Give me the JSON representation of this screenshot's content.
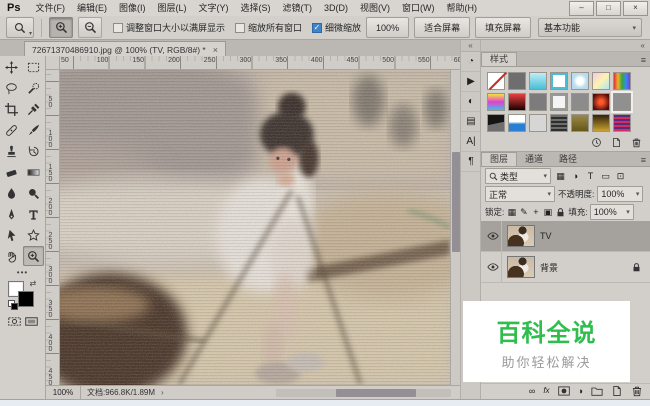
{
  "window": {
    "minimize": "–",
    "maximize": "□",
    "close": "×"
  },
  "menu_bar": {
    "logo": "Ps",
    "items": [
      "文件(F)",
      "编辑(E)",
      "图像(I)",
      "图层(L)",
      "文字(Y)",
      "选择(S)",
      "滤镜(T)",
      "3D(D)",
      "视图(V)",
      "窗口(W)",
      "帮助(H)"
    ]
  },
  "options_bar": {
    "checkboxes": [
      {
        "label": "调整窗口大小以满屏显示",
        "checked": false
      },
      {
        "label": "缩放所有窗口",
        "checked": false
      },
      {
        "label": "细微缩放",
        "checked": true
      }
    ],
    "buttons": [
      "100%",
      "适合屏幕",
      "填充屏幕"
    ],
    "workspace": "基本功能"
  },
  "document_tab": {
    "title": "72671370486910.jpg @ 100% (TV, RGB/8#) *",
    "close": "×"
  },
  "toolbar": {
    "rows": [
      [
        {
          "name": "move-tool",
          "icon": "move"
        },
        {
          "name": "marquee-tool",
          "icon": "marquee"
        }
      ],
      [
        {
          "name": "lasso-tool",
          "icon": "lasso"
        },
        {
          "name": "quick-selection-tool",
          "icon": "wand"
        }
      ],
      [
        {
          "name": "crop-tool",
          "icon": "crop"
        },
        {
          "name": "eyedropper-tool",
          "icon": "eyedropper"
        }
      ],
      [
        {
          "name": "healing-brush-tool",
          "icon": "healing"
        },
        {
          "name": "brush-tool",
          "icon": "brush"
        }
      ],
      [
        {
          "name": "clone-stamp-tool",
          "icon": "stamp"
        },
        {
          "name": "history-brush-tool",
          "icon": "hbrush"
        }
      ],
      [
        {
          "name": "eraser-tool",
          "icon": "eraser"
        },
        {
          "name": "gradient-tool",
          "icon": "gradient"
        }
      ],
      [
        {
          "name": "blur-tool",
          "icon": "blur"
        },
        {
          "name": "dodge-tool",
          "icon": "dodge"
        }
      ],
      [
        {
          "name": "pen-tool",
          "icon": "pen"
        },
        {
          "name": "type-tool",
          "icon": "type"
        }
      ],
      [
        {
          "name": "path-selection-tool",
          "icon": "pathsel"
        },
        {
          "name": "custom-shape-tool",
          "icon": "shape"
        }
      ],
      [
        {
          "name": "hand-tool",
          "icon": "hand"
        },
        {
          "name": "zoom-tool",
          "icon": "zoomin",
          "selected": true
        }
      ]
    ],
    "more_label": "•••",
    "foreground_color": "#ffffff",
    "background_color": "#000000"
  },
  "rulers": {
    "horizontal_labels": [
      50,
      100,
      150,
      200,
      250,
      300,
      350,
      400,
      450,
      500,
      550,
      600
    ],
    "vertical_labels": [
      50,
      100,
      150,
      200,
      250,
      300,
      350,
      400,
      450
    ]
  },
  "status_bar": {
    "zoom": "100%",
    "document_info": "文档:966.8K/1.89M",
    "arrow": "›"
  },
  "panel_strip": [
    {
      "name": "history-panel-icon",
      "glyph": "◔"
    },
    {
      "name": "actions-panel-icon",
      "glyph": "▶"
    },
    {
      "name": "adjustments-panel-icon",
      "glyph": "◐"
    },
    {
      "name": "layer-comps-panel-icon",
      "glyph": "▤"
    },
    {
      "name": "character-panel-icon",
      "glyph": "A|"
    },
    {
      "name": "paragraph-panel-icon",
      "glyph": "¶"
    }
  ],
  "styles_panel": {
    "tab": "样式",
    "menu_glyph": "≡",
    "swatches": [
      {
        "name": "style-none",
        "css": "#ffffff",
        "slash": true
      },
      {
        "name": "style-dark-gray",
        "css": "#6e6e6e"
      },
      {
        "name": "style-cyan",
        "css": "linear-gradient(180deg,#bfeef7,#49bdd8)"
      },
      {
        "name": "style-cyan-ring",
        "css": "#ffffff",
        "ring": "#49bdd8"
      },
      {
        "name": "style-blue-dot",
        "css": "radial-gradient(circle,#ffffff 28%,#b8dcee 62%)"
      },
      {
        "name": "style-pastel",
        "css": "linear-gradient(135deg,#f6c6e6,#fff2ae,#aee6f6)"
      },
      {
        "name": "style-rainbow-stripes",
        "css": "linear-gradient(90deg,#d93333,#f0b22e,#3aa53a,#2e8ef0,#8a33e0)"
      },
      {
        "name": "style-rainbow",
        "css": "linear-gradient(180deg,#f2e342,#e23fcf,#3fc0e8)"
      },
      {
        "name": "style-red-black",
        "css": "linear-gradient(180deg,#e84040,#1c0000)"
      },
      {
        "name": "style-gray-1",
        "css": "#7c7c7c"
      },
      {
        "name": "style-white-outline",
        "css": "#f4f4f4",
        "ring": "#999999"
      },
      {
        "name": "style-gray-2",
        "css": "#8c8c8c"
      },
      {
        "name": "style-red-radial",
        "css": "radial-gradient(circle,#ff5a2a 18%,#570a0a 80%)"
      },
      {
        "name": "style-gray-selected",
        "css": "#909090",
        "selected": true
      },
      {
        "name": "style-black-wave",
        "css": "linear-gradient(168deg,#151515 52%,#6e6e6e 53%)"
      },
      {
        "name": "style-blue-wave",
        "css": "linear-gradient(180deg,#ffffff 42%,#2a7fd4 58%)"
      },
      {
        "name": "style-light-gray",
        "css": "#d6d6d6"
      },
      {
        "name": "style-dark-stripes",
        "css": "repeating-linear-gradient(0deg,#2e2e2e 0 2px,#6e6e6e 2px 4px)"
      },
      {
        "name": "style-olive",
        "css": "linear-gradient(180deg,#9a8a4a,#655718)"
      },
      {
        "name": "style-dark-gold",
        "css": "linear-gradient(180deg,#32230c,#c8a22e)"
      },
      {
        "name": "style-purple-red",
        "css": "repeating-linear-gradient(0deg,#cf3060 0 2px,#5a2a80 2px 4px)"
      }
    ]
  },
  "layers_panel": {
    "tabs": [
      {
        "label": "图层",
        "active": true
      },
      {
        "label": "通道",
        "active": false
      },
      {
        "label": "路径",
        "active": false
      }
    ],
    "menu_glyph": "≡",
    "kind_filter_label": "类型",
    "filter_icons": [
      {
        "name": "filter-pixel-layers-icon",
        "glyph": "▦"
      },
      {
        "name": "filter-adjustment-layers-icon",
        "glyph": "◑"
      },
      {
        "name": "filter-type-layers-icon",
        "glyph": "T"
      },
      {
        "name": "filter-shape-layers-icon",
        "glyph": "▭"
      },
      {
        "name": "filter-smart-objects-icon",
        "glyph": "⊡"
      }
    ],
    "blend_mode": "正常",
    "opacity_label": "不透明度:",
    "opacity_value": "100%",
    "lock_label": "锁定:",
    "lock_icons": [
      {
        "name": "lock-transparency-icon",
        "glyph": "▦"
      },
      {
        "name": "lock-pixels-icon",
        "glyph": "✎"
      },
      {
        "name": "lock-position-icon",
        "glyph": "+"
      },
      {
        "name": "lock-artboard-icon",
        "glyph": "▣"
      }
    ],
    "fill_label": "填充:",
    "fill_value": "100%",
    "layers": [
      {
        "name": "TV",
        "selected": true,
        "visible": true,
        "locked": false
      },
      {
        "name": "背景",
        "selected": false,
        "visible": true,
        "locked": true
      }
    ]
  },
  "watermark": {
    "title": "百科全说",
    "subtitle": "助你轻松解决",
    "accent_color": "#2fbe4e"
  },
  "colors": {
    "chrome": "#d5d2cd",
    "chrome_dark": "#bbb8b3",
    "checkbox_checked": "#3f84c6",
    "selected_layer_row": "#a5a29d",
    "watermark_green": "#2fbe4e"
  }
}
